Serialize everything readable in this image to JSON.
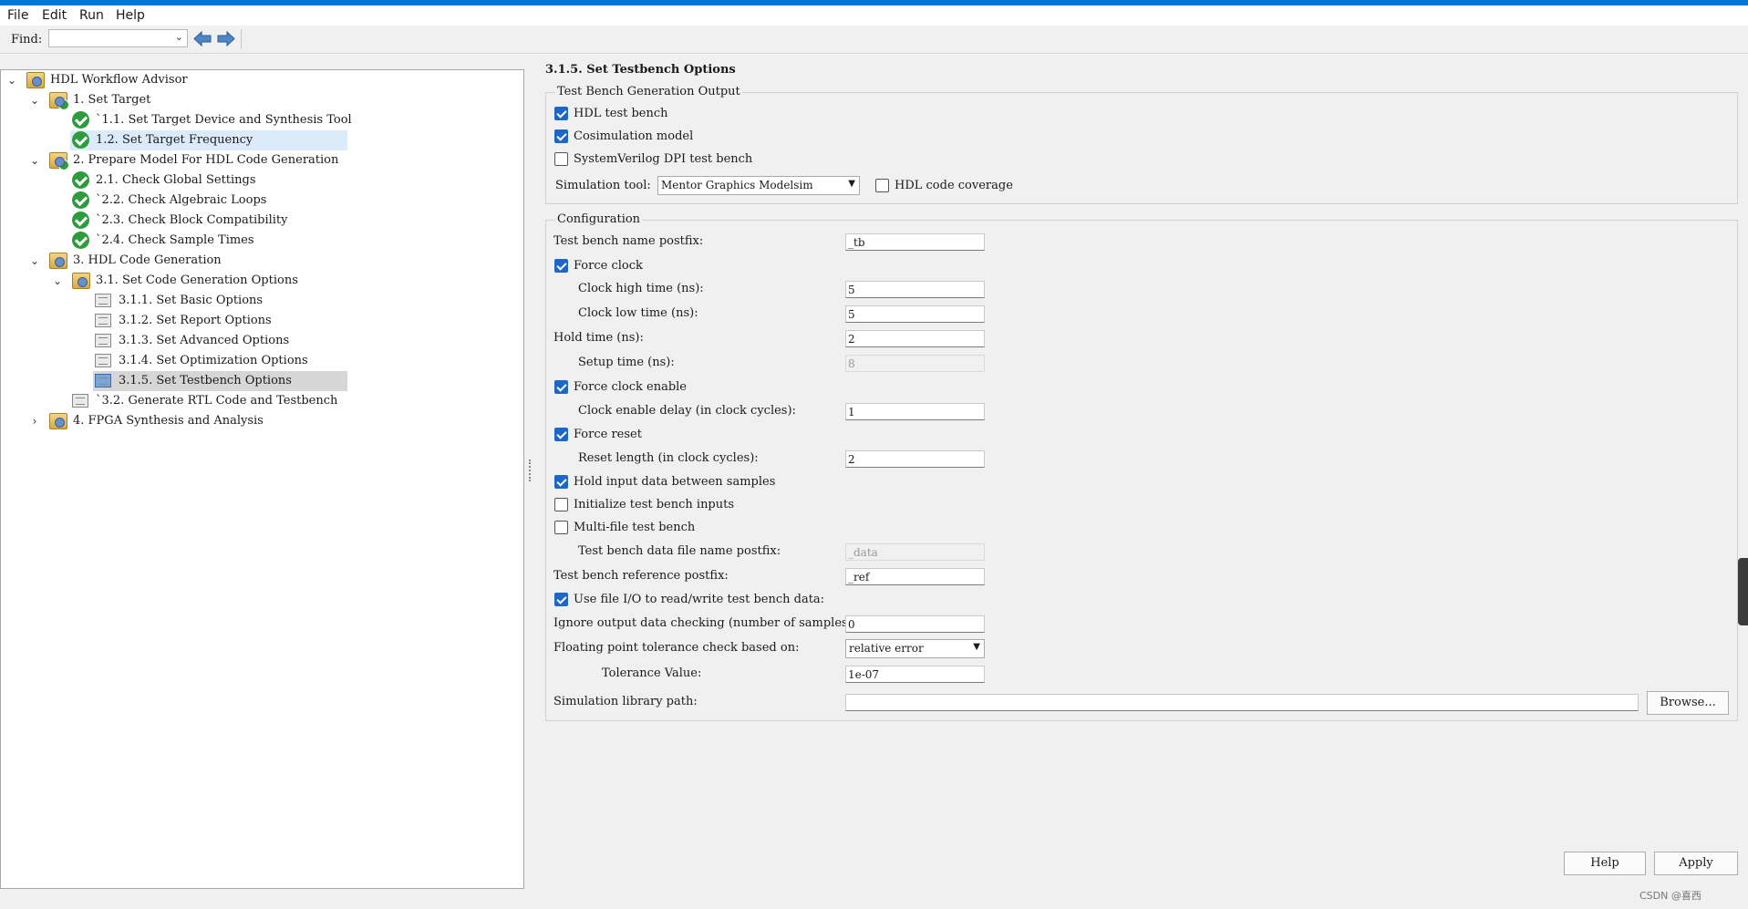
{
  "menu": [
    "File",
    "Edit",
    "Run",
    "Help"
  ],
  "find": {
    "label": "Find:",
    "value": ""
  },
  "tree": [
    {
      "label": "HDL Workflow Advisor"
    },
    {
      "label": "1. Set Target"
    },
    {
      "label": "`1.1. Set Target Device and Synthesis Tool"
    },
    {
      "label": "1.2. Set Target Frequency"
    },
    {
      "label": "2. Prepare Model For HDL Code Generation"
    },
    {
      "label": "2.1. Check Global Settings"
    },
    {
      "label": "`2.2. Check Algebraic Loops"
    },
    {
      "label": "`2.3. Check Block Compatibility"
    },
    {
      "label": "`2.4. Check Sample Times"
    },
    {
      "label": "3. HDL Code Generation"
    },
    {
      "label": "3.1. Set Code Generation Options"
    },
    {
      "label": "3.1.1. Set Basic Options"
    },
    {
      "label": "3.1.2. Set Report Options"
    },
    {
      "label": "3.1.3. Set Advanced Options"
    },
    {
      "label": "3.1.4. Set Optimization Options"
    },
    {
      "label": "3.1.5. Set Testbench Options"
    },
    {
      "label": "`3.2. Generate RTL Code and Testbench"
    },
    {
      "label": "4. FPGA Synthesis and Analysis"
    }
  ],
  "page_title": "3.1.5. Set Testbench Options",
  "output_group": {
    "title": "Test Bench Generation Output",
    "hdl_test_bench": {
      "label": "HDL test bench",
      "checked": true
    },
    "cosimulation_model": {
      "label": "Cosimulation model",
      "checked": true
    },
    "sv_dpi": {
      "label": "SystemVerilog DPI test bench",
      "checked": false
    },
    "sim_tool_label": "Simulation tool:",
    "sim_tool_value": "Mentor Graphics Modelsim",
    "code_coverage": {
      "label": "HDL code coverage",
      "checked": false
    }
  },
  "config_group": {
    "title": "Configuration",
    "tb_name_postfix": {
      "label": "Test bench name postfix:",
      "value": "_tb"
    },
    "force_clock": {
      "label": "Force clock",
      "checked": true
    },
    "clock_high": {
      "label": "Clock high time (ns):",
      "value": "5"
    },
    "clock_low": {
      "label": "Clock low time (ns):",
      "value": "5"
    },
    "hold_time": {
      "label": "Hold time (ns):",
      "value": "2"
    },
    "setup_time": {
      "label": "Setup time (ns):",
      "value": "8"
    },
    "force_clock_enable": {
      "label": "Force clock enable",
      "checked": true
    },
    "clock_enable_delay": {
      "label": "Clock enable delay (in clock cycles):",
      "value": "1"
    },
    "force_reset": {
      "label": "Force reset",
      "checked": true
    },
    "reset_length": {
      "label": "Reset length (in clock cycles):",
      "value": "2"
    },
    "hold_input": {
      "label": "Hold input data between samples",
      "checked": true
    },
    "init_inputs": {
      "label": "Initialize test bench inputs",
      "checked": false
    },
    "multi_file": {
      "label": "Multi-file test bench",
      "checked": false
    },
    "data_file_postfix": {
      "label": "Test bench data file name postfix:",
      "value": "_data"
    },
    "ref_postfix": {
      "label": "Test bench reference postfix:",
      "value": "_ref"
    },
    "file_io": {
      "label": "Use file I/O to read/write test bench data:",
      "checked": true
    },
    "ignore_output": {
      "label": "Ignore output data checking (number of samples):",
      "value": "0"
    },
    "fp_tolerance": {
      "label": "Floating point tolerance check based on:",
      "value": "relative error"
    },
    "tolerance_value": {
      "label": "Tolerance Value:",
      "value": "1e-07"
    },
    "sim_lib_path": {
      "label": "Simulation library path:",
      "value": ""
    },
    "browse_label": "Browse..."
  },
  "buttons": {
    "help": "Help",
    "apply": "Apply"
  },
  "watermark": "CSDN @喜西",
  "colors": {
    "accent": "#0a74d0",
    "check": "#2e9b3c",
    "checkbox": "#1e66c8"
  }
}
